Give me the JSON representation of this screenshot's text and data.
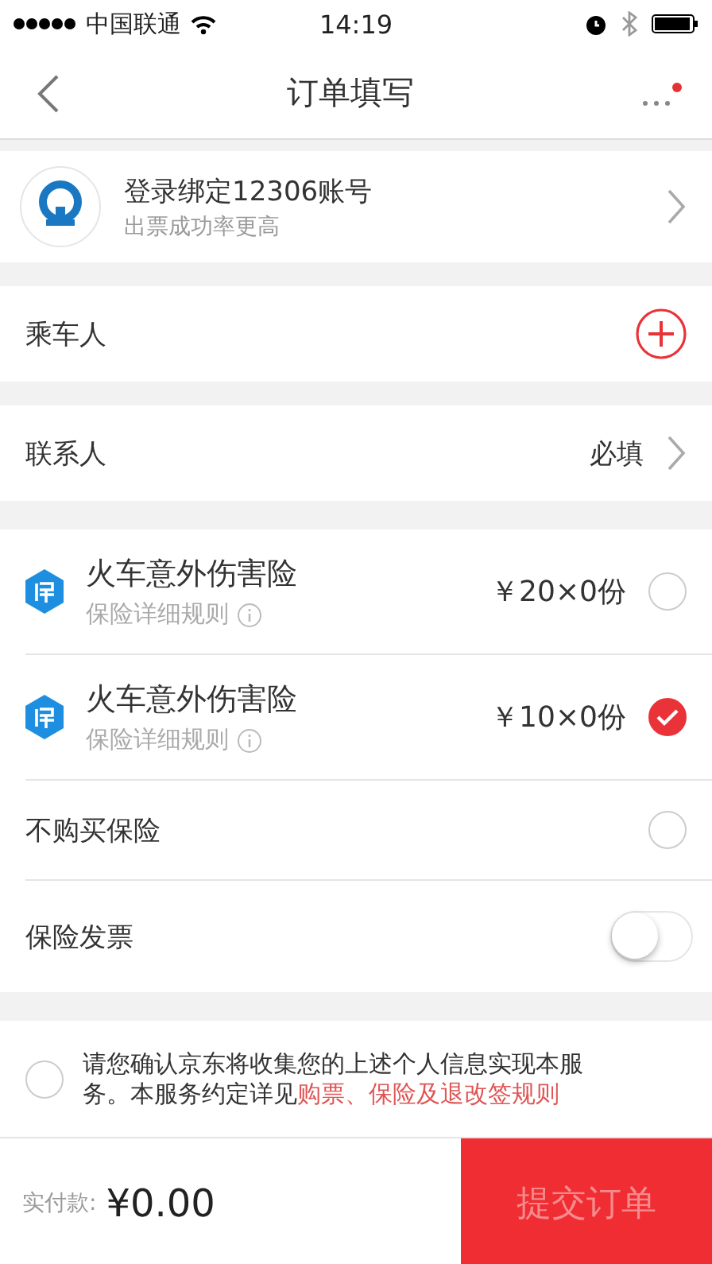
{
  "status_bar": {
    "carrier": "中国联通",
    "time": "14:19"
  },
  "nav": {
    "title": "订单填写",
    "has_notice": true
  },
  "account": {
    "title": "登录绑定12306账号",
    "subtitle": "出票成功率更高"
  },
  "passengers": {
    "label": "乘车人"
  },
  "contact": {
    "label": "联系人",
    "value": "必填"
  },
  "insurance": [
    {
      "kind": "plan",
      "title": "火车意外伤害险",
      "detail": "保险详细规则",
      "price": "￥20×0份",
      "selected": false
    },
    {
      "kind": "plan",
      "title": "火车意外伤害险",
      "detail": "保险详细规则",
      "price": "￥10×0份",
      "selected": true
    },
    {
      "kind": "none",
      "title": "不购买保险",
      "selected": false
    },
    {
      "kind": "toggle",
      "title": "保险发票",
      "on": false
    }
  ],
  "agreement": {
    "text": "请您确认京东将收集您的上述个人信息实现本服务。本服务约定详见",
    "link": "购票、保险及退改签规则",
    "checked": false
  },
  "footer": {
    "label": "实付款:",
    "amount": "¥0.00",
    "submit": "提交订单",
    "submit_disabled": true
  }
}
